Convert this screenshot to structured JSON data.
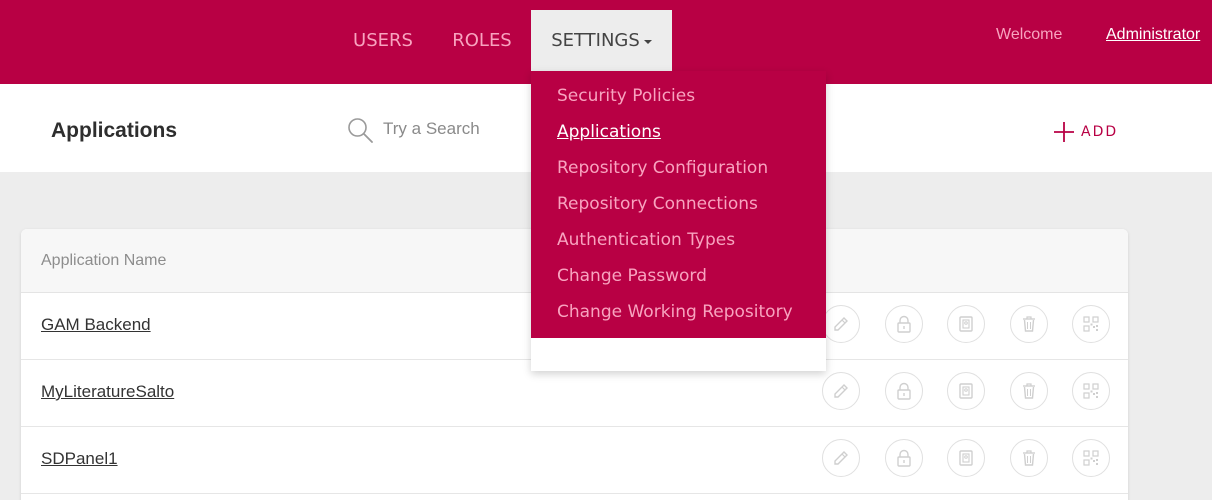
{
  "nav": {
    "users": "USERS",
    "roles": "ROLES",
    "settings": "SETTINGS",
    "welcome": "Welcome",
    "user": "Administrator"
  },
  "header": {
    "title": "Applications",
    "search_placeholder": "Try a Search",
    "add_label": "ADD"
  },
  "settings_menu": {
    "items": [
      {
        "label": "Security Policies",
        "active": false
      },
      {
        "label": "Applications",
        "active": true
      },
      {
        "label": "Repository Configuration",
        "active": false
      },
      {
        "label": "Repository Connections",
        "active": false
      },
      {
        "label": "Authentication Types",
        "active": false
      },
      {
        "label": "Change Password",
        "active": false
      },
      {
        "label": "Change Working Repository",
        "active": false
      }
    ]
  },
  "table": {
    "column_header": "Application Name",
    "rows": [
      {
        "name": "GAM Backend"
      },
      {
        "name": "MyLiteratureSalto"
      },
      {
        "name": "SDPanel1"
      }
    ],
    "actions": [
      "edit-icon",
      "lock-icon",
      "contact-card-icon",
      "trash-icon",
      "qr-code-icon"
    ]
  },
  "colors": {
    "brand": "#b80044",
    "nav_text": "#f8a3bf",
    "icon_gray": "#cfcfcf"
  }
}
